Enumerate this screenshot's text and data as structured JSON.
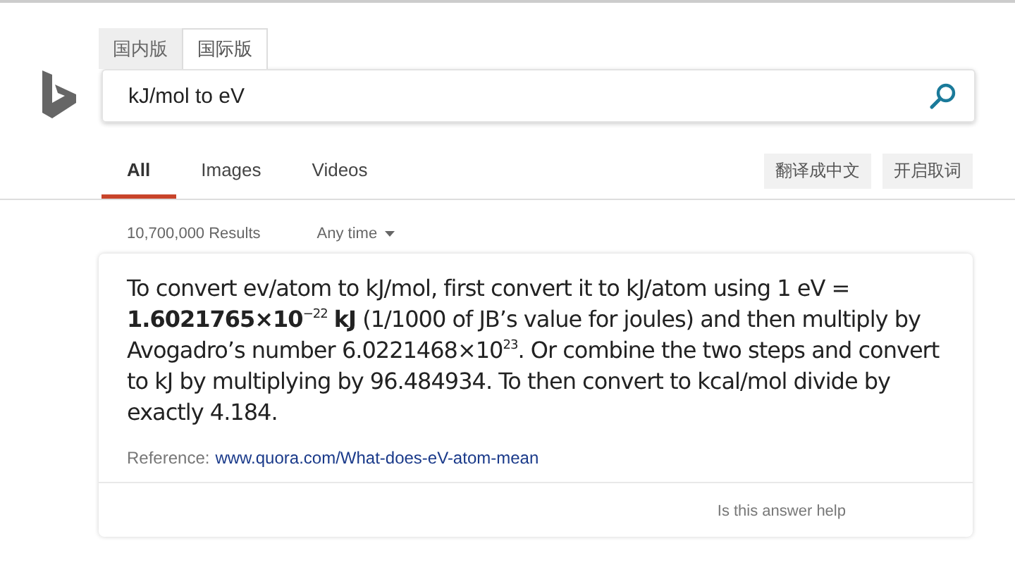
{
  "region_tabs": [
    {
      "label": "国内版",
      "selected": false
    },
    {
      "label": "国际版",
      "selected": true
    }
  ],
  "search": {
    "value": "kJ/mol to eV"
  },
  "nav_tabs": [
    {
      "label": "All",
      "selected": true
    },
    {
      "label": "Images",
      "selected": false
    },
    {
      "label": "Videos",
      "selected": false
    }
  ],
  "actions": [
    "翻译成中文",
    "开启取词"
  ],
  "result_count": "10,700,000 Results",
  "time_filter": "Any time",
  "answer": {
    "text": "To convert ev/atom to kJ/mol, first convert it to kJ/atom using 1 eV = **1.6021765×10**$^{−22}$ **kJ** (1/1000 of JB’s value for joules) and then multiply by Avogadro’s number 6.0221468×10$^{23}$. Or combine the two steps and convert to kJ by multiplying by 96.484934. To then convert to kcal/mol divide by exactly 4.184.",
    "reference_label": "Reference:",
    "reference_link": "www.quora.com/What-does-eV-atom-mean",
    "feedback": "Is this answer help"
  }
}
